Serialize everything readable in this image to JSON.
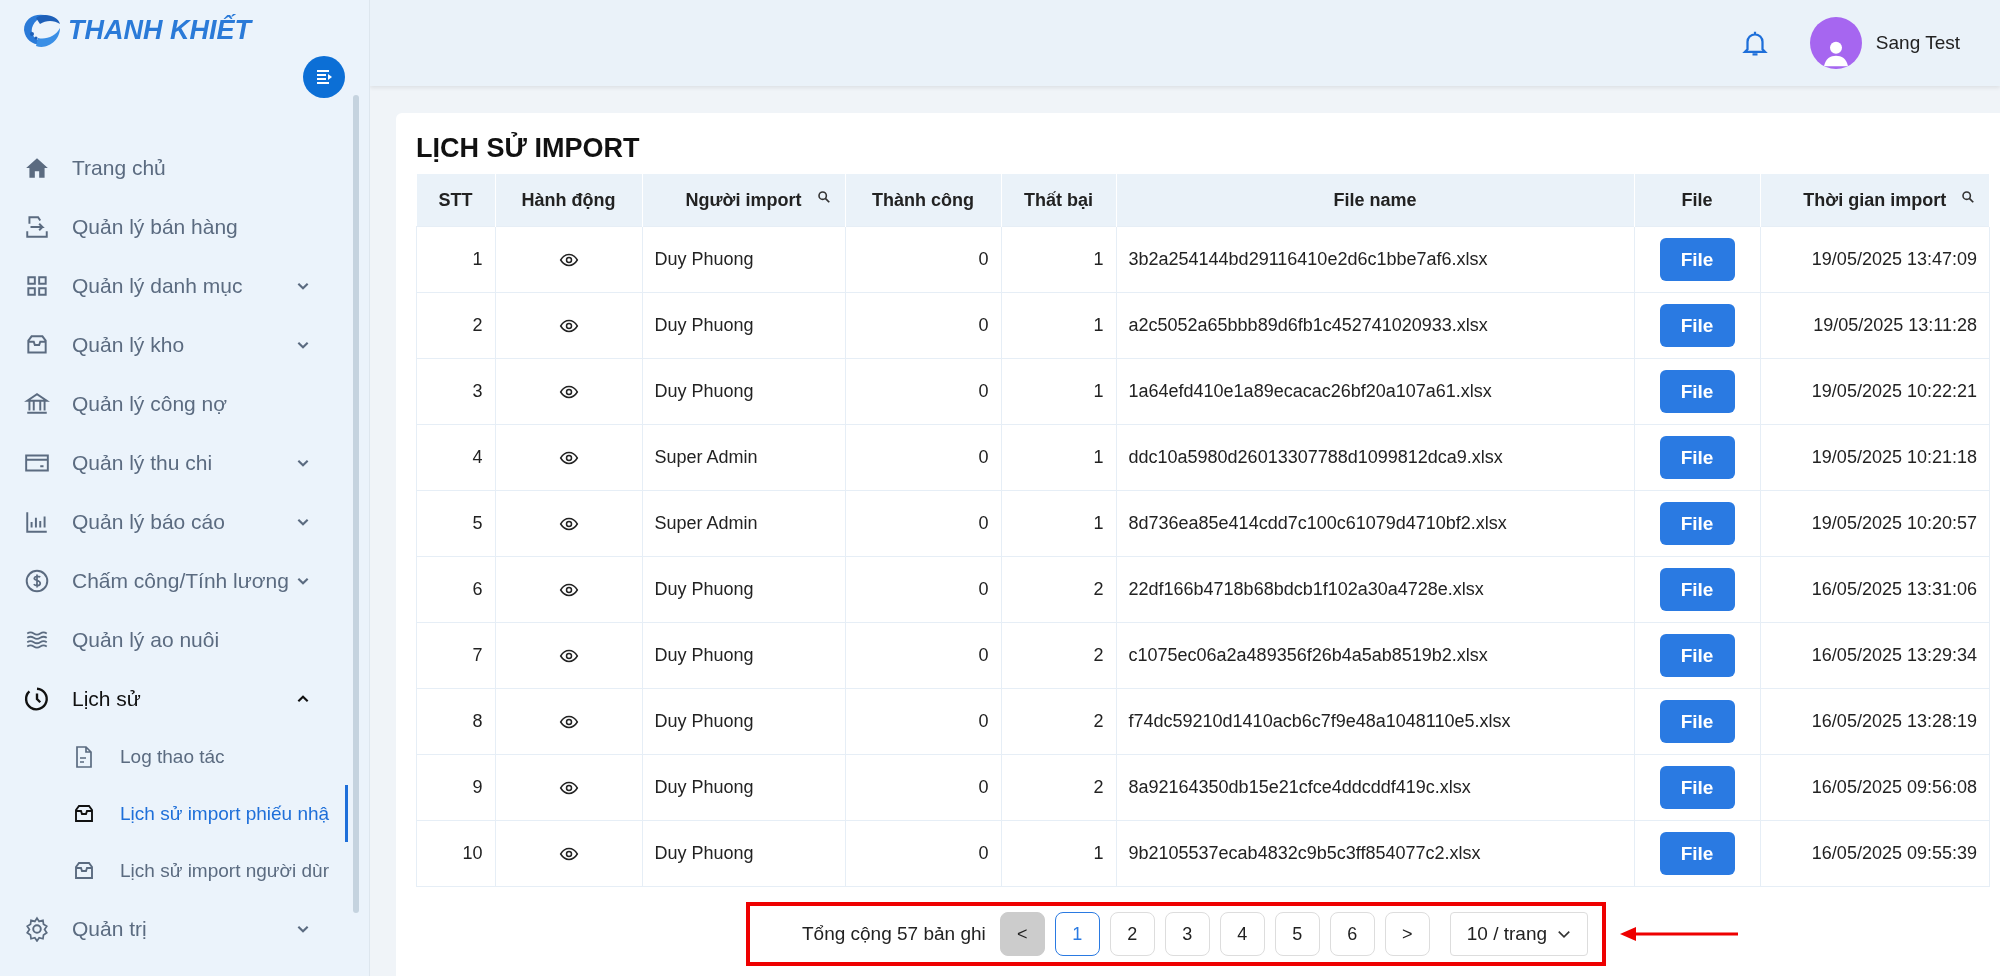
{
  "brand": {
    "name": "THANH KHIẾT"
  },
  "sidebar": {
    "items": [
      {
        "label": "Trang chủ",
        "kind": "link",
        "selected": false
      },
      {
        "label": "Quản lý bán hàng",
        "kind": "link",
        "selected": false
      },
      {
        "label": "Quản lý danh mục",
        "kind": "group",
        "expanded": false,
        "selected": false
      },
      {
        "label": "Quản lý kho",
        "kind": "group",
        "expanded": false,
        "selected": false
      },
      {
        "label": "Quản lý công nợ",
        "kind": "link",
        "selected": false
      },
      {
        "label": "Quản lý thu chi",
        "kind": "group",
        "expanded": false,
        "selected": false
      },
      {
        "label": "Quản lý báo cáo",
        "kind": "group",
        "expanded": false,
        "selected": false
      },
      {
        "label": "Chấm công/Tính lương",
        "kind": "group",
        "expanded": false,
        "selected": false
      },
      {
        "label": "Quản lý ao nuôi",
        "kind": "link",
        "selected": false
      },
      {
        "label": "Lịch sử",
        "kind": "group",
        "expanded": true,
        "selected": false,
        "children": [
          {
            "label": "Log thao tác",
            "selected": false
          },
          {
            "label": "Lịch sử import phiếu nhậ",
            "selected": true
          },
          {
            "label": "Lịch sử import người dùr",
            "selected": false
          }
        ]
      },
      {
        "label": "Quản trị",
        "kind": "group",
        "expanded": false,
        "selected": false
      }
    ]
  },
  "header": {
    "user": "Sang Test"
  },
  "page_title": "LỊCH SỬ IMPORT",
  "table": {
    "columns": [
      {
        "label": "STT",
        "searchable": false
      },
      {
        "label": "Hành động",
        "searchable": false
      },
      {
        "label": "Người import",
        "searchable": true
      },
      {
        "label": "Thành công",
        "searchable": false
      },
      {
        "label": "Thất bại",
        "searchable": false
      },
      {
        "label": "File name",
        "searchable": false
      },
      {
        "label": "File",
        "searchable": false
      },
      {
        "label": "Thời gian import",
        "searchable": true
      }
    ],
    "rows": [
      {
        "stt": "1",
        "user": "Duy Phuong",
        "success": "0",
        "failed": "1",
        "file_name": "3b2a254144bd29116410e2d6c1bbe7af6.xlsx",
        "file_button": "File",
        "time": "19/05/2025 13:47:09"
      },
      {
        "stt": "2",
        "user": "Duy Phuong",
        "success": "0",
        "failed": "1",
        "file_name": "a2c5052a65bbb89d6fb1c452741020933.xlsx",
        "file_button": "File",
        "time": "19/05/2025 13:11:28"
      },
      {
        "stt": "3",
        "user": "Duy Phuong",
        "success": "0",
        "failed": "1",
        "file_name": "1a64efd410e1a89ecacac26bf20a107a61.xlsx",
        "file_button": "File",
        "time": "19/05/2025 10:22:21"
      },
      {
        "stt": "4",
        "user": "Super Admin",
        "success": "0",
        "failed": "1",
        "file_name": "ddc10a5980d26013307788d1099812dca9.xlsx",
        "file_button": "File",
        "time": "19/05/2025 10:21:18"
      },
      {
        "stt": "5",
        "user": "Super Admin",
        "success": "0",
        "failed": "1",
        "file_name": "8d736ea85e414cdd7c100c61079d4710bf2.xlsx",
        "file_button": "File",
        "time": "19/05/2025 10:20:57"
      },
      {
        "stt": "6",
        "user": "Duy Phuong",
        "success": "0",
        "failed": "2",
        "file_name": "22df166b4718b68bdcb1f102a30a4728e.xlsx",
        "file_button": "File",
        "time": "16/05/2025 13:31:06"
      },
      {
        "stt": "7",
        "user": "Duy Phuong",
        "success": "0",
        "failed": "2",
        "file_name": "c1075ec06a2a489356f26b4a5ab8519b2.xlsx",
        "file_button": "File",
        "time": "16/05/2025 13:29:34"
      },
      {
        "stt": "8",
        "user": "Duy Phuong",
        "success": "0",
        "failed": "2",
        "file_name": "f74dc59210d1410acb6c7f9e48a1048110e5.xlsx",
        "file_button": "File",
        "time": "16/05/2025 13:28:19"
      },
      {
        "stt": "9",
        "user": "Duy Phuong",
        "success": "0",
        "failed": "2",
        "file_name": "8a92164350db15e21cfce4ddcddf419c.xlsx",
        "file_button": "File",
        "time": "16/05/2025 09:56:08"
      },
      {
        "stt": "10",
        "user": "Duy Phuong",
        "success": "0",
        "failed": "1",
        "file_name": "9b2105537ecab4832c9b5c3ff854077c2.xlsx",
        "file_button": "File",
        "time": "16/05/2025 09:55:39"
      }
    ]
  },
  "pagination": {
    "total": "Tổng cộng 57 bản ghi",
    "prev": {
      "label": "<",
      "disabled": true
    },
    "pages": [
      {
        "label": "1",
        "selected": true
      },
      {
        "label": "2",
        "selected": false
      },
      {
        "label": "3",
        "selected": false
      },
      {
        "label": "4",
        "selected": false
      },
      {
        "label": "5",
        "selected": false
      },
      {
        "label": "6",
        "selected": false
      }
    ],
    "next": {
      "label": ">",
      "disabled": false
    },
    "page_size": "10 / trang",
    "highlighted": true
  }
}
